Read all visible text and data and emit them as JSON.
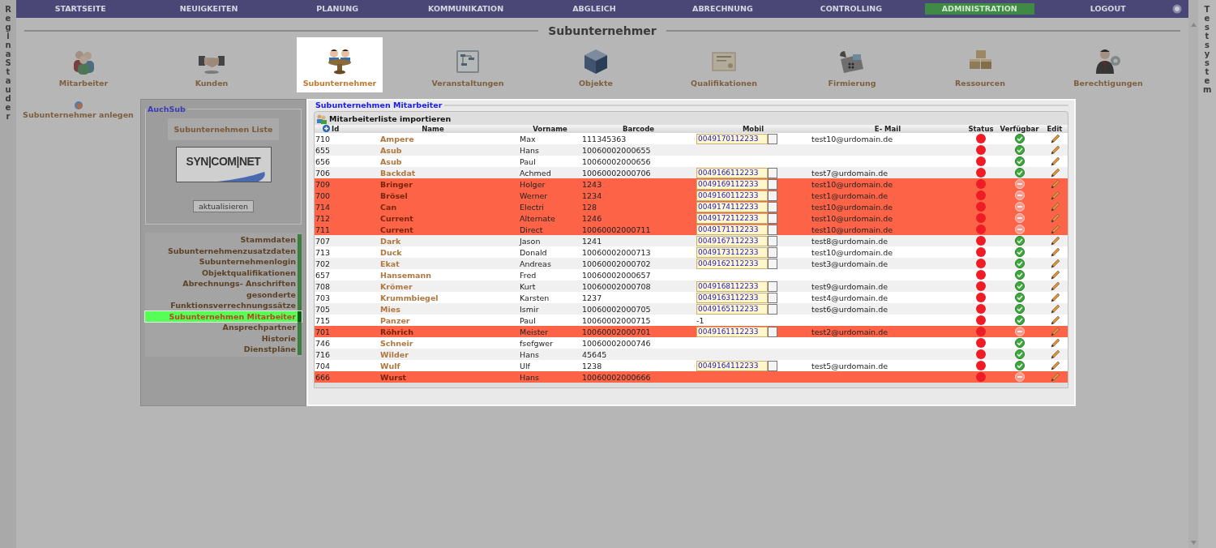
{
  "side_left": {
    "text": "Regina Stauder"
  },
  "side_right": {
    "text": "Testsystem"
  },
  "nav": [
    {
      "label": "STARTSEITE",
      "selected": false
    },
    {
      "label": "NEUIGKEITEN",
      "selected": false
    },
    {
      "label": "PLANUNG",
      "selected": false
    },
    {
      "label": "KOMMUNIKATION",
      "selected": false
    },
    {
      "label": "ABGLEICH",
      "selected": false
    },
    {
      "label": "ABRECHNUNG",
      "selected": false
    },
    {
      "label": "CONTROLLING",
      "selected": false
    },
    {
      "label": "ADMINISTRATION",
      "selected": true
    },
    {
      "label": "LOGOUT",
      "selected": false
    }
  ],
  "page_title": "Subunternehmer",
  "modules": [
    {
      "label": "Mitarbeiter",
      "selected": false
    },
    {
      "label": "Kunden",
      "selected": false
    },
    {
      "label": "Subunternehmer",
      "selected": true
    },
    {
      "label": "Veranstaltungen",
      "selected": false
    },
    {
      "label": "Objekte",
      "selected": false
    },
    {
      "label": "Qualifikationen",
      "selected": false
    },
    {
      "label": "Firmierung",
      "selected": false
    },
    {
      "label": "Ressourcen",
      "selected": false
    },
    {
      "label": "Berechtigungen",
      "selected": false
    }
  ],
  "create_link": "Subunternehmer anlegen",
  "sidebar": {
    "legend": "AuchSub",
    "list_button": "Subunternehmen Liste",
    "logo": "SYN|COM|NET",
    "refresh_button": "aktualisieren",
    "items": [
      {
        "label": "Stammdaten",
        "selected": false
      },
      {
        "label": "Subunternehmenzusatzdaten",
        "selected": false
      },
      {
        "label": "Subunternehmenlogin",
        "selected": false
      },
      {
        "label": "Objektqualifikationen",
        "selected": false
      },
      {
        "label": "Abrechnungs- Anschriften",
        "selected": false
      },
      {
        "label": "gesonderte Funktionsverrechnungssätze",
        "selected": false
      },
      {
        "label": "Subunternehmen Mitarbeiter",
        "selected": true
      },
      {
        "label": "Ansprechpartner",
        "selected": false
      },
      {
        "label": "Historie",
        "selected": false
      },
      {
        "label": "Dienstpläne",
        "selected": false
      }
    ]
  },
  "employees": {
    "legend": "Subunternehmen Mitarbeiter",
    "import": "Mitarbeiterliste importieren",
    "columns": [
      "Id",
      "Name",
      "Vorname",
      "Barcode",
      "Mobil",
      "E- Mail",
      "Status",
      "Verfügbar",
      "Edit"
    ],
    "rows": [
      {
        "id": "710",
        "name": "Ampere",
        "first": "Max",
        "barcode": "111345363",
        "mobile": {
          "kind": "field",
          "value": "0049170112233"
        },
        "email": "test10@urdomain.de",
        "available": true
      },
      {
        "id": "655",
        "name": "Asub",
        "first": "Hans",
        "barcode": "10060002000655",
        "available": true
      },
      {
        "id": "656",
        "name": "Asub",
        "first": "Paul",
        "barcode": "10060002000656",
        "available": true
      },
      {
        "id": "706",
        "name": "Backdat",
        "first": "Achmed",
        "barcode": "10060002000706",
        "mobile": {
          "kind": "field",
          "value": "0049166112233"
        },
        "email": "test7@urdomain.de",
        "available": true
      },
      {
        "id": "709",
        "name": "Bringer",
        "first": "Holger",
        "barcode": "1243",
        "mobile": {
          "kind": "field",
          "value": "0049169112233"
        },
        "email": "test10@urdomain.de",
        "available": false
      },
      {
        "id": "700",
        "name": "Brösel",
        "first": "Werner",
        "barcode": "1234",
        "mobile": {
          "kind": "field",
          "value": "0049160112233"
        },
        "email": "test1@urdomain.de",
        "available": false
      },
      {
        "id": "714",
        "name": "Can",
        "first": "Electri",
        "barcode": "128",
        "mobile": {
          "kind": "field",
          "value": "0049174112233"
        },
        "email": "test10@urdomain.de",
        "available": false
      },
      {
        "id": "712",
        "name": "Current",
        "first": "Alternate",
        "barcode": "1246",
        "mobile": {
          "kind": "field",
          "value": "0049172112233"
        },
        "email": "test10@urdomain.de",
        "available": false
      },
      {
        "id": "711",
        "name": "Current",
        "first": "Direct",
        "barcode": "10060002000711",
        "mobile": {
          "kind": "field",
          "value": "0049171112233"
        },
        "email": "test10@urdomain.de",
        "available": false
      },
      {
        "id": "707",
        "name": "Dark",
        "first": "Jason",
        "barcode": "1241",
        "mobile": {
          "kind": "field",
          "value": "0049167112233"
        },
        "email": "test8@urdomain.de",
        "available": true
      },
      {
        "id": "713",
        "name": "Duck",
        "first": "Donald",
        "barcode": "10060002000713",
        "mobile": {
          "kind": "field",
          "value": "0049173112233"
        },
        "email": "test10@urdomain.de",
        "available": true
      },
      {
        "id": "702",
        "name": "Ekat",
        "first": "Andreas",
        "barcode": "10060002000702",
        "mobile": {
          "kind": "field",
          "value": "0049162112233"
        },
        "email": "test3@urdomain.de",
        "available": true
      },
      {
        "id": "657",
        "name": "Hansemann",
        "first": "Fred",
        "barcode": "10060002000657",
        "available": true
      },
      {
        "id": "708",
        "name": "Krömer",
        "first": "Kurt",
        "barcode": "10060002000708",
        "mobile": {
          "kind": "field",
          "value": "0049168112233"
        },
        "email": "test9@urdomain.de",
        "available": true
      },
      {
        "id": "703",
        "name": "Krummbiegel",
        "first": "Karsten",
        "barcode": "1237",
        "mobile": {
          "kind": "field",
          "value": "0049163112233"
        },
        "email": "test4@urdomain.de",
        "available": true
      },
      {
        "id": "705",
        "name": "Mies",
        "first": "Ismir",
        "barcode": "10060002000705",
        "mobile": {
          "kind": "field",
          "value": "0049165112233"
        },
        "email": "test6@urdomain.de",
        "available": true
      },
      {
        "id": "715",
        "name": "Panzer",
        "first": "Paul",
        "barcode": "10060002000715",
        "mobile": {
          "kind": "text",
          "value": "-1"
        },
        "available": true
      },
      {
        "id": "701",
        "name": "Röhrich",
        "first": "Meister",
        "barcode": "10060002000701",
        "mobile": {
          "kind": "field",
          "value": "0049161112233"
        },
        "email": "test2@urdomain.de",
        "available": false
      },
      {
        "id": "746",
        "name": "Schneir",
        "first": "fsefgwer",
        "barcode": "10060002000746",
        "available": true
      },
      {
        "id": "716",
        "name": "Wilder",
        "first": "Hans",
        "barcode": "45645",
        "available": true
      },
      {
        "id": "704",
        "name": "Wulf",
        "first": "Ulf",
        "barcode": "1238",
        "mobile": {
          "kind": "field",
          "value": "0049164112233"
        },
        "email": "test5@urdomain.de",
        "available": true
      },
      {
        "id": "666",
        "name": "Wurst",
        "first": "Hans",
        "barcode": "10060002000666",
        "available": false
      }
    ]
  }
}
